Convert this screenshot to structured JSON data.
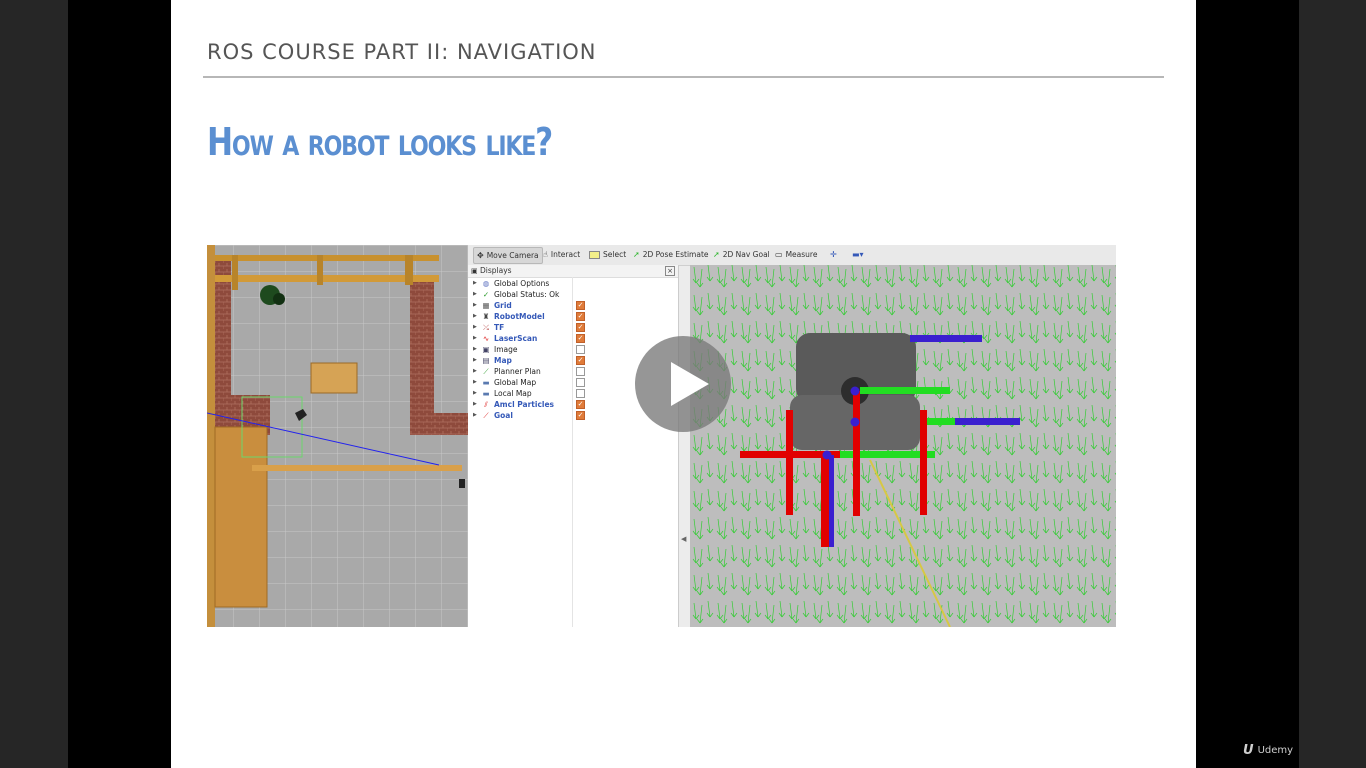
{
  "slide": {
    "course_title": "ROS COURSE PART II: NAVIGATION",
    "heading": "How a robot looks like?"
  },
  "rviz": {
    "toolbar": [
      {
        "icon": "move-camera-icon",
        "label": "Move Camera",
        "active": true
      },
      {
        "icon": "interact-icon",
        "label": "Interact"
      },
      {
        "icon": "select-icon",
        "label": "Select"
      },
      {
        "icon": "pose-estimate-icon",
        "label": "2D Pose Estimate"
      },
      {
        "icon": "nav-goal-icon",
        "label": "2D Nav Goal"
      },
      {
        "icon": "measure-icon",
        "label": "Measure"
      }
    ],
    "displays_title": "Displays",
    "displays": [
      {
        "label": "Global Options",
        "icon": "globe-icon",
        "highlight": false,
        "checkbox": null
      },
      {
        "label": "Global Status: Ok",
        "icon": "check-icon",
        "highlight": false,
        "checkbox": null
      },
      {
        "label": "Grid",
        "icon": "grid-icon",
        "highlight": true,
        "checkbox": true
      },
      {
        "label": "RobotModel",
        "icon": "robot-icon",
        "highlight": true,
        "checkbox": true
      },
      {
        "label": "TF",
        "icon": "tf-icon",
        "highlight": true,
        "checkbox": true
      },
      {
        "label": "LaserScan",
        "icon": "laser-icon",
        "highlight": true,
        "checkbox": true
      },
      {
        "label": "Image",
        "icon": "image-icon",
        "highlight": false,
        "checkbox": false
      },
      {
        "label": "Map",
        "icon": "map-icon",
        "highlight": true,
        "checkbox": true
      },
      {
        "label": "Planner Plan",
        "icon": "path-icon",
        "highlight": false,
        "checkbox": false
      },
      {
        "label": "Global Map",
        "icon": "folder-icon",
        "highlight": false,
        "checkbox": false
      },
      {
        "label": "Local Map",
        "icon": "folder-icon",
        "highlight": false,
        "checkbox": false
      },
      {
        "label": "Amcl Particles",
        "icon": "particles-icon",
        "highlight": true,
        "checkbox": true
      },
      {
        "label": "Goal",
        "icon": "goal-icon",
        "highlight": true,
        "checkbox": true
      }
    ]
  },
  "watermark": {
    "mark": "U",
    "label": "Udemy"
  },
  "colors": {
    "heading": "#5b8fd1",
    "highlight_label": "#3559b8",
    "checkbox_on": "#e07b39",
    "axis_x": "#e10000",
    "axis_y": "#22dd22",
    "axis_z": "#3a1fcf",
    "particles": "#33cc33"
  }
}
